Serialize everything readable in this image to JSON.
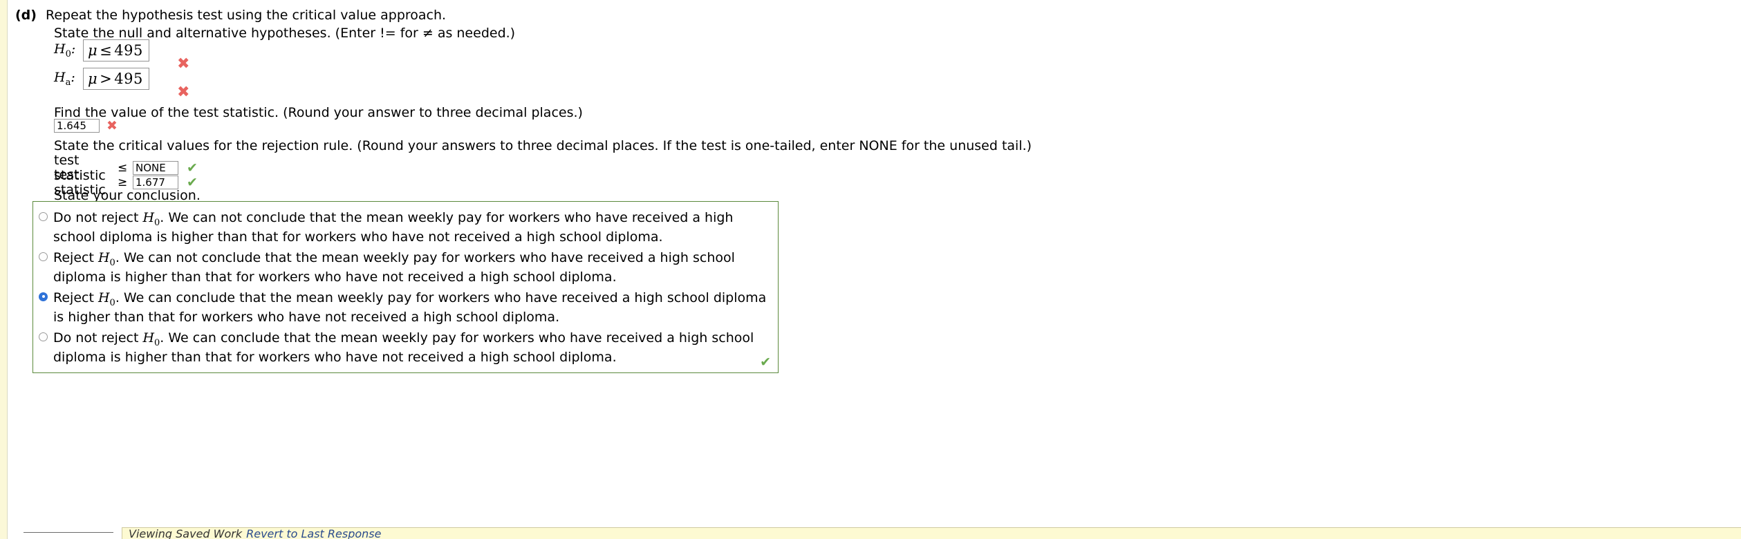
{
  "part": {
    "label": "(d)",
    "text": "Repeat the hypothesis test using the critical value approach."
  },
  "prompts": {
    "state_hypotheses": "State the null and alternative hypotheses. (Enter != for ≠ as needed.)",
    "find_statistic": "Find the value of the test statistic. (Round your answer to three decimal places.)",
    "critical_values": "State the critical values for the rejection rule. (Round your answers to three decimal places. If the test is one-tailed, enter NONE for the unused tail.)",
    "conclusion": "State your conclusion."
  },
  "hypotheses": [
    {
      "name_base": "H",
      "name_sub": "0",
      "value_symbol": "μ",
      "value_operator": "≤",
      "value_number": "495",
      "mark": "✖",
      "mark_type": "cross"
    },
    {
      "name_base": "H",
      "name_sub": "a",
      "value_symbol": "μ",
      "value_operator": ">",
      "value_number": "495",
      "mark": "✖",
      "mark_type": "cross"
    }
  ],
  "test_statistic": {
    "value": "1.645",
    "mark": "✖",
    "mark_type": "cross"
  },
  "critical_rows": [
    {
      "label": "test statistic",
      "operator": "≤",
      "value": "NONE",
      "mark": "✔",
      "mark_type": "check"
    },
    {
      "label": "test statistic",
      "operator": "≥",
      "value": "1.677",
      "mark": "✔",
      "mark_type": "check"
    }
  ],
  "conclusion_options": [
    {
      "lead": "Do not reject ",
      "hyp_base": "H",
      "hyp_sub": "0",
      "rest": ". We can not conclude that the mean weekly pay for workers who have received a high school diploma is higher than that for workers who have not received a high school diploma.",
      "selected": false
    },
    {
      "lead": "Reject ",
      "hyp_base": "H",
      "hyp_sub": "0",
      "rest": ". We can not conclude that the mean weekly pay for workers who have received a high school diploma is higher than that for workers who have not received a high school diploma.",
      "selected": false
    },
    {
      "lead": "Reject ",
      "hyp_base": "H",
      "hyp_sub": "0",
      "rest": ". We can conclude that the mean weekly pay for workers who have received a high school diploma is higher than that for workers who have not received a high school diploma.",
      "selected": true
    },
    {
      "lead": "Do not reject ",
      "hyp_base": "H",
      "hyp_sub": "0",
      "rest": ". We can conclude that the mean weekly pay for workers who have received a high school diploma is higher than that for workers who have not received a high school diploma.",
      "selected": false
    }
  ],
  "conclusion_box_mark": "✔",
  "footer": {
    "saved_label": "Viewing Saved Work",
    "revert_link": "Revert to Last Response"
  },
  "colors": {
    "cross": "#e8635f",
    "check": "#6aaa4e",
    "radio_selected": "#2f72d8",
    "box_border": "#5b8a3c",
    "saved_bar_bg": "#fdfad2"
  }
}
